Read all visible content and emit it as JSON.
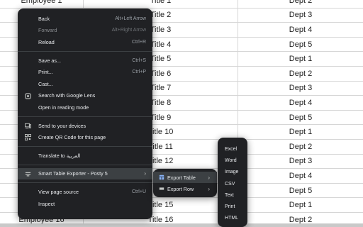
{
  "table": {
    "rows": [
      [
        "Employee 1",
        "Title 1",
        "Dept 2"
      ],
      [
        "",
        "Title 2",
        "Dept 3"
      ],
      [
        "",
        "Title 3",
        "Dept 4"
      ],
      [
        "",
        "Title 4",
        "Dept 5"
      ],
      [
        "",
        "Title 5",
        "Dept 1"
      ],
      [
        "",
        "Title 6",
        "Dept 2"
      ],
      [
        "",
        "Title 7",
        "Dept 3"
      ],
      [
        "",
        "Title 8",
        "Dept 4"
      ],
      [
        "",
        "Title 9",
        "Dept 5"
      ],
      [
        "",
        "Title 10",
        "Dept 1"
      ],
      [
        "",
        "Title 11",
        "Dept 2"
      ],
      [
        "",
        "Title 12",
        "Dept 3"
      ],
      [
        "",
        "",
        "Dept 4"
      ],
      [
        "",
        "",
        "Dept 5"
      ],
      [
        "",
        "Title 15",
        "Dept 1"
      ],
      [
        "Employee 16",
        "Title 16",
        "Dept 2"
      ]
    ]
  },
  "context_menu": {
    "back": {
      "label": "Back",
      "shortcut": "Alt+Left Arrow"
    },
    "forward": {
      "label": "Forward",
      "shortcut": "Alt+Right Arrow"
    },
    "reload": {
      "label": "Reload",
      "shortcut": "Ctrl+R"
    },
    "save_as": {
      "label": "Save as...",
      "shortcut": "Ctrl+S"
    },
    "print": {
      "label": "Print...",
      "shortcut": "Ctrl+P"
    },
    "cast": {
      "label": "Cast..."
    },
    "lens": {
      "label": "Search with Google Lens"
    },
    "reading_mode": {
      "label": "Open in reading mode"
    },
    "send_devices": {
      "label": "Send to your devices"
    },
    "qr_code": {
      "label": "Create QR Code for this page"
    },
    "translate": {
      "label": "Translate to العربية"
    },
    "extension": {
      "label": "Smart Table Exporter - Posty 5"
    },
    "view_source": {
      "label": "View page source",
      "shortcut": "Ctrl+U"
    },
    "inspect": {
      "label": "Inspect"
    }
  },
  "submenu": {
    "export_table": "Export Table",
    "export_row": "Export Row"
  },
  "export_formats": [
    "Excel",
    "Word",
    "Image",
    "CSV",
    "Text",
    "Print",
    "HTML"
  ],
  "colors": {
    "menu_bg": "#202124",
    "highlight": "#3c4043"
  }
}
